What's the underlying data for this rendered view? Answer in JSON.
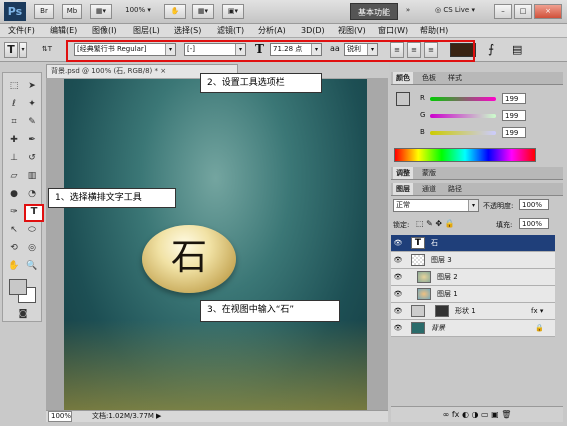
{
  "titlebar": {
    "logo": "Ps",
    "buttons": [
      "Br",
      "Mb"
    ],
    "zoom": "100%",
    "workspace": "基本功能",
    "expand": "»",
    "cslive": "CS Live",
    "window_min": "–",
    "window_max": "□",
    "window_close": "×"
  },
  "menu": [
    "文件(F)",
    "编辑(E)",
    "图像(I)",
    "图层(L)",
    "选择(S)",
    "滤镜(T)",
    "分析(A)",
    "3D(D)",
    "视图(V)",
    "窗口(W)",
    "帮助(H)"
  ],
  "options": {
    "tool_glyph": "T",
    "orient_glyph": "⇅T",
    "font_family": "[经典繁行书 Regular]",
    "font_style": "[-]",
    "size_glyph": "T",
    "font_size": "71.28 点",
    "aa_label": "aa",
    "anti_alias": "锐利",
    "align_left": "≡",
    "align_center": "≡",
    "align_right": "≡",
    "text_color": "#3a2414",
    "warp": "⨍",
    "panels": "▤"
  },
  "document": {
    "tab_label": "背景.psd @ 100% (石, RGB/8) *",
    "tab_close": "×",
    "text_layer_char": "石",
    "zoom": "100%",
    "doc_info": "文档:1.02M/3.77M"
  },
  "callouts": {
    "step1": "1、选择横排文字工具",
    "step2": "2、设置工具选项栏",
    "step3": "3、在视图中输入“石”"
  },
  "color_panel": {
    "tabs": [
      "颜色",
      "色板",
      "样式"
    ],
    "channels": [
      {
        "label": "R",
        "value": "199"
      },
      {
        "label": "G",
        "value": "199"
      },
      {
        "label": "B",
        "value": "199"
      }
    ]
  },
  "adjust_tabs": [
    "调整",
    "蒙版"
  ],
  "layers_panel": {
    "tabs": [
      "图层",
      "通道",
      "路径"
    ],
    "blend_mode": "正常",
    "opacity_label": "不透明度:",
    "opacity": "100%",
    "lock_label": "锁定:",
    "fill_label": "填充:",
    "fill": "100%",
    "layers": [
      {
        "name": "石",
        "thumb": "T",
        "selected": true
      },
      {
        "name": "图层 3",
        "thumb": "",
        "selected": false
      },
      {
        "name": "图层 2",
        "thumb": "",
        "selected": false
      },
      {
        "name": "图层 1",
        "thumb": "",
        "selected": false
      },
      {
        "name": "形状 1",
        "thumb": "",
        "selected": false,
        "fx": "fx ▾"
      },
      {
        "name": "背景",
        "thumb": "",
        "selected": false
      }
    ],
    "footer_icons": "∞ fx ◐ ◑ ▭ ▣ 🗑"
  },
  "colors": {
    "accent_red": "#e01010",
    "selection_blue": "#1f3f7a",
    "foreground": "#c8c8c8",
    "background": "#ffffff"
  }
}
